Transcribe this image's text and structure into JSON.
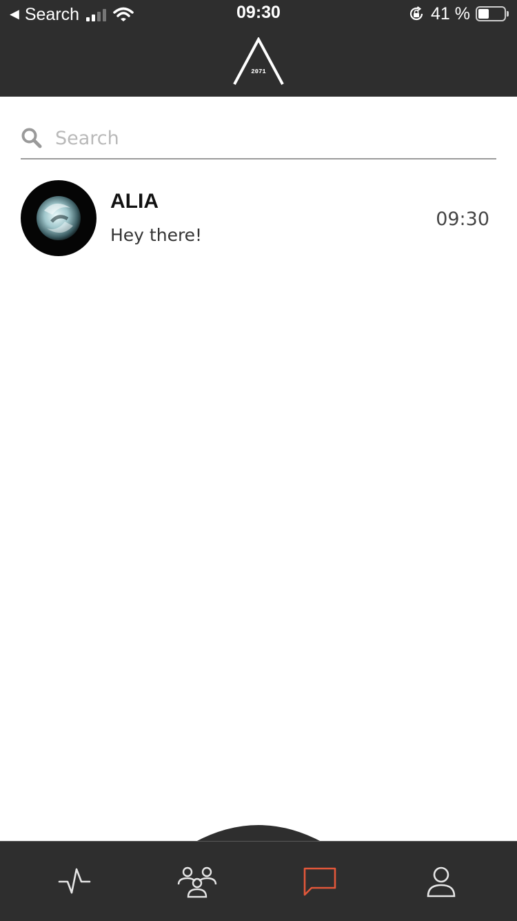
{
  "status_bar": {
    "back_label": "Search",
    "time": "09:30",
    "battery_percent": "41 %",
    "battery_level": 0.41
  },
  "header": {
    "logo_text": "2071"
  },
  "search": {
    "placeholder": "Search",
    "value": ""
  },
  "conversations": [
    {
      "name": "ALIA",
      "last_message": "Hey there!",
      "time": "09:30"
    }
  ],
  "tab_bar": {
    "tabs": [
      {
        "icon": "activity-icon",
        "active": false
      },
      {
        "icon": "community-icon",
        "active": false
      },
      {
        "icon": "chat-icon",
        "active": true
      },
      {
        "icon": "profile-icon",
        "active": false
      }
    ],
    "active_color": "#e2573a",
    "inactive_color": "#e6e6e6"
  },
  "colors": {
    "header_bg": "#2e2e2e",
    "accent": "#e2573a"
  }
}
